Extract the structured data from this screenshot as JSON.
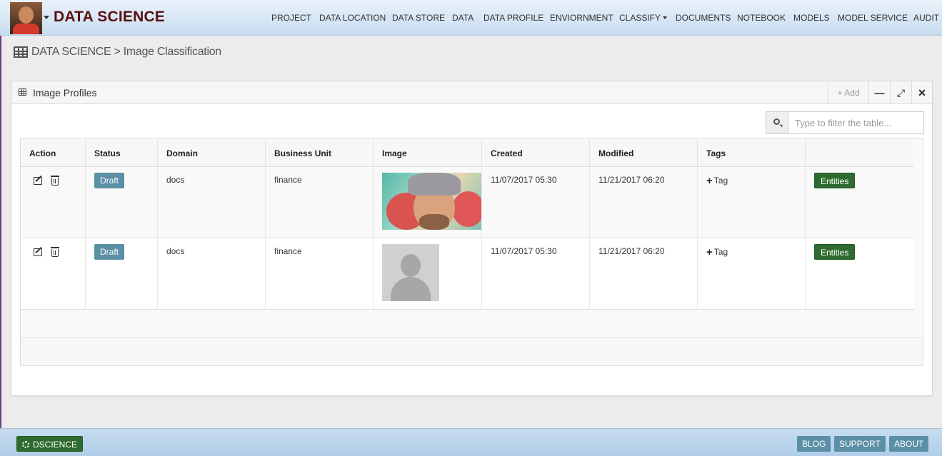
{
  "header": {
    "brand": "DATA SCIENCE",
    "nav": [
      {
        "label": "PROJECT",
        "dropdown": false
      },
      {
        "label": "DATA LOCATION",
        "dropdown": false
      },
      {
        "label": "DATA STORE",
        "dropdown": false
      },
      {
        "label": "DATA",
        "dropdown": false
      },
      {
        "label": "DATA PROFILE",
        "dropdown": false
      },
      {
        "label": "ENVIORNMENT",
        "dropdown": false
      },
      {
        "label": "CLASSIFY",
        "dropdown": true
      },
      {
        "label": "DOCUMENTS",
        "dropdown": false
      },
      {
        "label": "NOTEBOOK",
        "dropdown": false
      },
      {
        "label": "MODELS",
        "dropdown": false
      },
      {
        "label": "MODEL SERVICE",
        "dropdown": false
      },
      {
        "label": "AUDIT",
        "dropdown": false
      }
    ]
  },
  "breadcrumb": "DATA SCIENCE > Image Classification",
  "panel": {
    "title": "Image Profiles",
    "add_label": "Add",
    "minimize_glyph": "—",
    "expand_glyph": "⤢",
    "close_glyph": "✕"
  },
  "filter": {
    "placeholder": "Type to filter the table..."
  },
  "table": {
    "headers": [
      "Action",
      "Status",
      "Domain",
      "Business Unit",
      "Image",
      "Created",
      "Modified",
      "Tags",
      ""
    ],
    "rows": [
      {
        "status": "Draft",
        "domain": "docs",
        "business_unit": "finance",
        "image": "photo",
        "created": "11/07/2017 05:30",
        "modified": "11/21/2017 06:20",
        "tag_label": "Tag",
        "entities_label": "Entities"
      },
      {
        "status": "Draft",
        "domain": "docs",
        "business_unit": "finance",
        "image": "placeholder-silhouette",
        "created": "11/07/2017 05:30",
        "modified": "11/21/2017 06:20",
        "tag_label": "Tag",
        "entities_label": "Entities"
      }
    ]
  },
  "footer": {
    "brand_label": "DSCIENCE",
    "blog_label": "BLOG",
    "support_label": "SUPPORT",
    "about_label": "ABOUT"
  },
  "colors": {
    "brand": "#5a1010",
    "draft_badge": "#5b8fa5",
    "entities_button": "#2e6b2e"
  }
}
